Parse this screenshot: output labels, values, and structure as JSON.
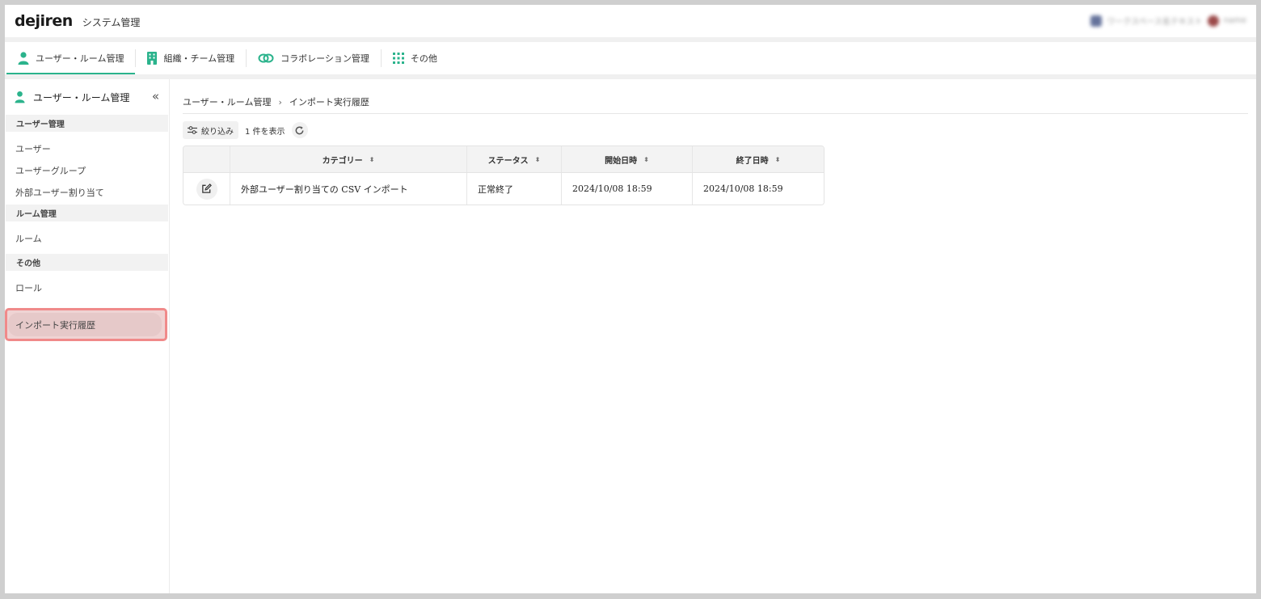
{
  "header": {
    "logo": "dejiren",
    "app_title": "システム管理",
    "user": {
      "org": "ワークスペース名テキスト",
      "name": "name"
    }
  },
  "tabs": [
    {
      "label": "ユーザー・ルーム管理",
      "icon": "person-icon",
      "active": true
    },
    {
      "label": "組織・チーム管理",
      "icon": "building-icon",
      "active": false
    },
    {
      "label": "コラボレーション管理",
      "icon": "link-icon",
      "active": false
    },
    {
      "label": "その他",
      "icon": "grid-icon",
      "active": false
    }
  ],
  "sidebar": {
    "title": "ユーザー・ルーム管理",
    "sections": [
      {
        "title": "ユーザー管理",
        "items": [
          "ユーザー",
          "ユーザーグループ",
          "外部ユーザー割り当て"
        ]
      },
      {
        "title": "ルーム管理",
        "items": [
          "ルーム"
        ]
      },
      {
        "title": "その他",
        "items": [
          "ロール",
          "インポート実行履歴"
        ]
      }
    ],
    "selected": "インポート実行履歴"
  },
  "breadcrumb": [
    "ユーザー・ルーム管理",
    "インポート実行履歴"
  ],
  "toolbar": {
    "filter_label": "絞り込み",
    "count_label": "1 件を表示"
  },
  "table": {
    "columns": [
      "カテゴリー",
      "ステータス",
      "開始日時",
      "終了日時"
    ],
    "rows": [
      {
        "category": "外部ユーザー割り当ての CSV インポート",
        "status": "正常終了",
        "start": "2024/10/08 18:59",
        "end": "2024/10/08 18:59"
      }
    ]
  },
  "colors": {
    "accent": "#2bb38c",
    "highlight_border": "#f08a8a"
  }
}
